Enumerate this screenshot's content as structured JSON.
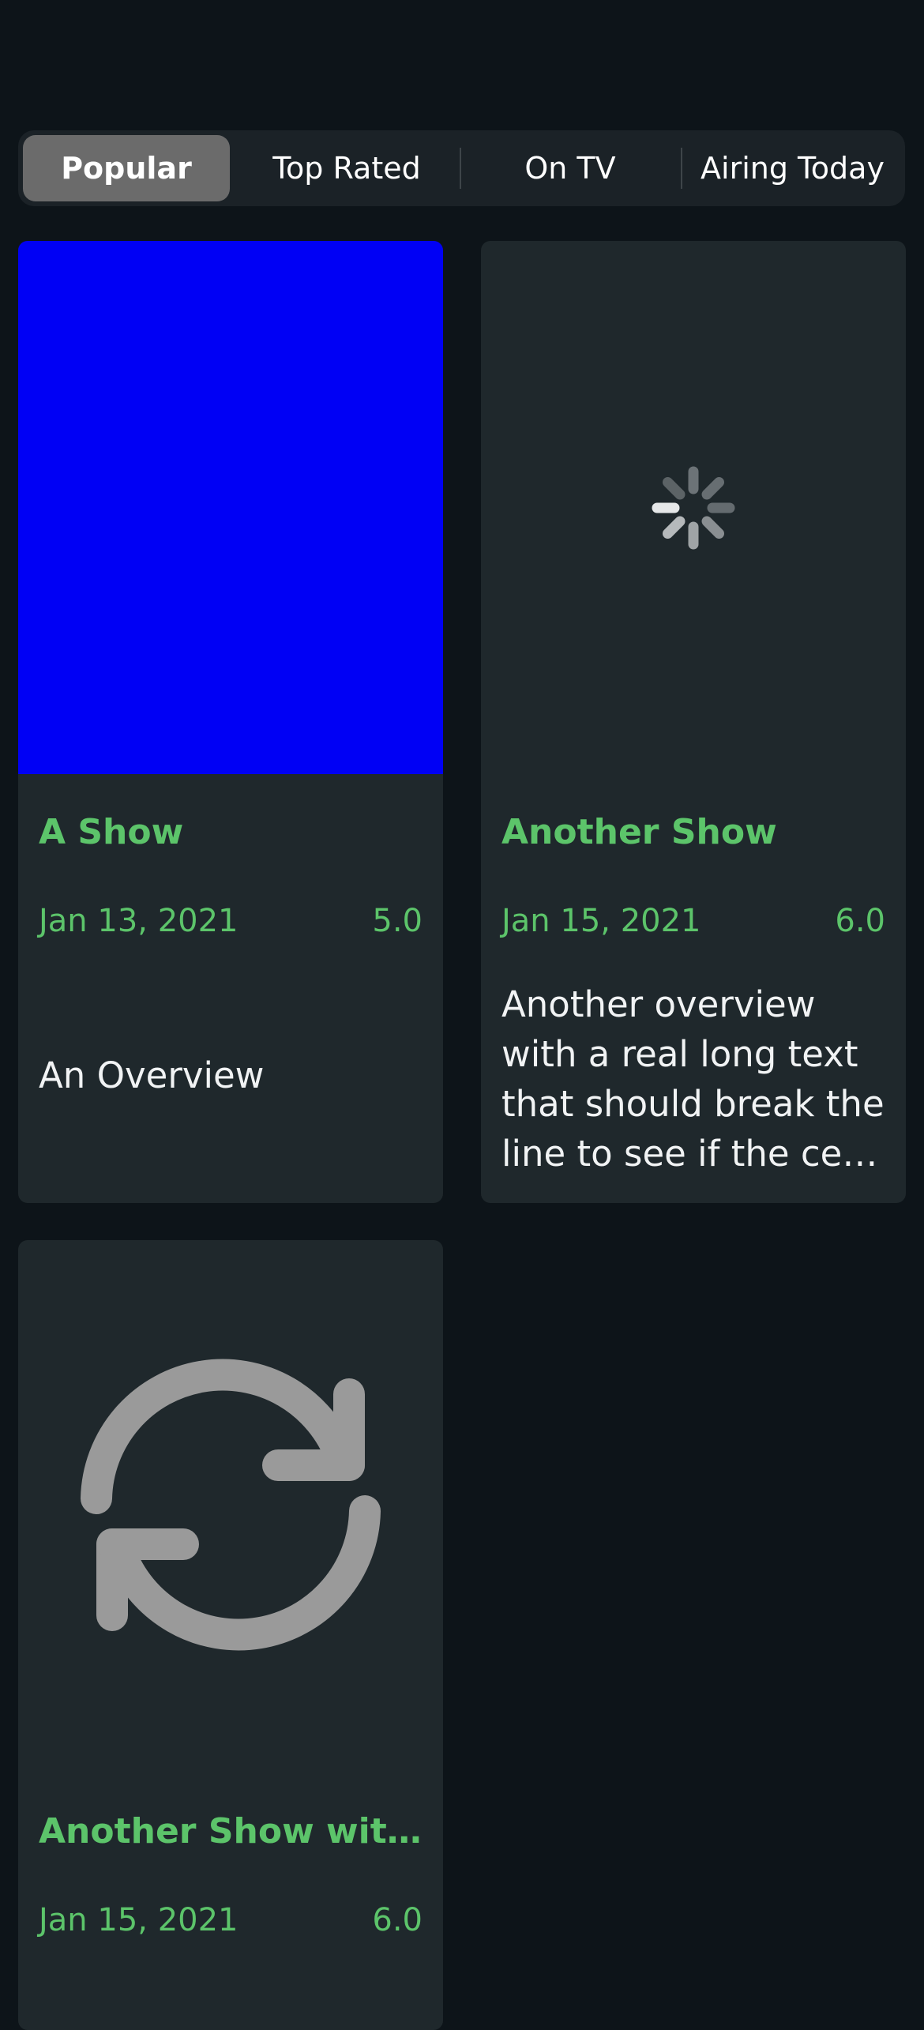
{
  "segments": {
    "items": [
      "Popular",
      "Top Rated",
      "On TV",
      "Airing Today"
    ],
    "selected": "Popular"
  },
  "cards": [
    {
      "title": "A Show",
      "date": "Jan 13, 2021",
      "rating": "5.0",
      "overview": "An Overview",
      "poster": "solid-blue-image",
      "poster_color": "#0000f5"
    },
    {
      "title": "Another Show",
      "date": "Jan 15, 2021",
      "rating": "6.0",
      "overview": "Another overview with a real long text that should break the line to see if the cell changes its height accordingly",
      "poster": "loading-spinner-icon"
    },
    {
      "title": "Another Show with a really long title",
      "date": "Jan 15, 2021",
      "rating": "6.0",
      "poster": "refresh-icon"
    }
  ],
  "colors": {
    "background": "#0d1419",
    "card": "#1f282c",
    "accent": "#5cc46a",
    "segment_selected": "#6b6b6b",
    "placeholder_icon": "#9a9a9a"
  }
}
